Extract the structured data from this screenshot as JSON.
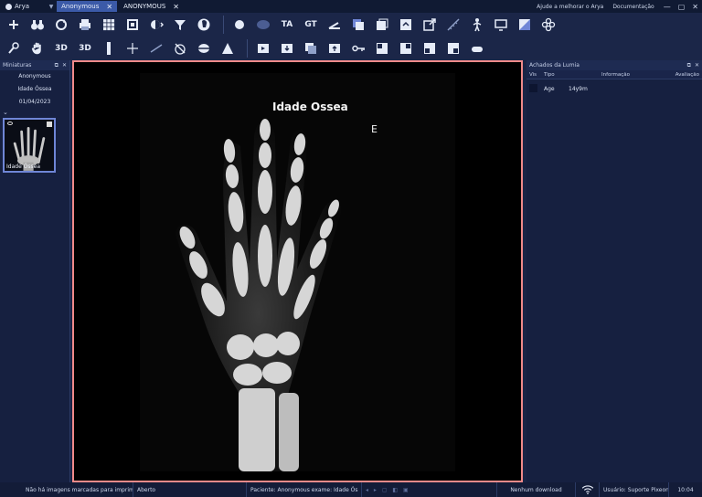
{
  "titlebar": {
    "app_name": "Arya",
    "tabs": [
      {
        "label": "Anonymous",
        "active": true
      },
      {
        "label": "ANONYMOUS",
        "active": false
      }
    ],
    "help_link": "Ajude a melhorar o Arya",
    "docs_link": "Documentação"
  },
  "toolbar": {
    "row1_icons": [
      "add-icon",
      "binoculars-icon",
      "rotate-icon",
      "print-icon",
      "grid-layout-icon",
      "fit-window-icon",
      "window-level-icon",
      "filter-icon",
      "head-scan-icon",
      "circle-icon",
      "ellipse-icon",
      "text-tag-icon",
      "tag-gt-icon",
      "angle-icon",
      "layers-2d-icon",
      "series-copy-icon",
      "series-export-icon",
      "external-link-icon",
      "measure-icon",
      "skeleton-icon",
      "monitor-icon",
      "invert-icon",
      "flower-icon"
    ],
    "row1_text": {
      "ta": "TA",
      "gt": "GT"
    },
    "row2_icons": [
      "probe-icon",
      "pan-hand-icon",
      "rotate-3d-icon",
      "mpr-3d-icon",
      "ruler-vertical-icon",
      "crosshair-icon",
      "line-measure-icon",
      "protractor-icon",
      "ellipse-roi-icon",
      "annotation-icon",
      "play-series-icon",
      "download-series-icon",
      "stack-icon",
      "upload-series-icon",
      "key-icon",
      "layout-1-icon",
      "layout-2-icon",
      "layout-3-icon",
      "layout-4-icon",
      "capsule-icon"
    ],
    "row2_text": {
      "label_3d_a": "3D",
      "label_3d_b": "3D"
    }
  },
  "left_panel": {
    "title": "Miniaturas",
    "patient": "Anonymous",
    "study": "Idade Óssea",
    "date": "01/04/2023",
    "thumbnail_label": "Idade Óssea"
  },
  "viewer": {
    "title": "Idade Ossea",
    "side_marker": "E"
  },
  "right_panel": {
    "title": "Achados da Lumia",
    "columns": [
      "Vis",
      "Tipo",
      "Informação",
      "Avaliação"
    ],
    "rows": [
      {
        "tipo": "Age",
        "info": "14y9m",
        "aval": ""
      }
    ]
  },
  "status": {
    "print_msg": "Não há imagens marcadas para imprimir",
    "state": "Aberto",
    "patient_info": "Paciente: Anonymous exame: Idade Ós",
    "download": "Nenhum download",
    "user": "Usuário: Suporte Pixeon",
    "time": "10:04"
  },
  "colors": {
    "accent_tab": "#3b5aa8",
    "viewer_border": "#f08a8a",
    "background": "#1a2445"
  }
}
